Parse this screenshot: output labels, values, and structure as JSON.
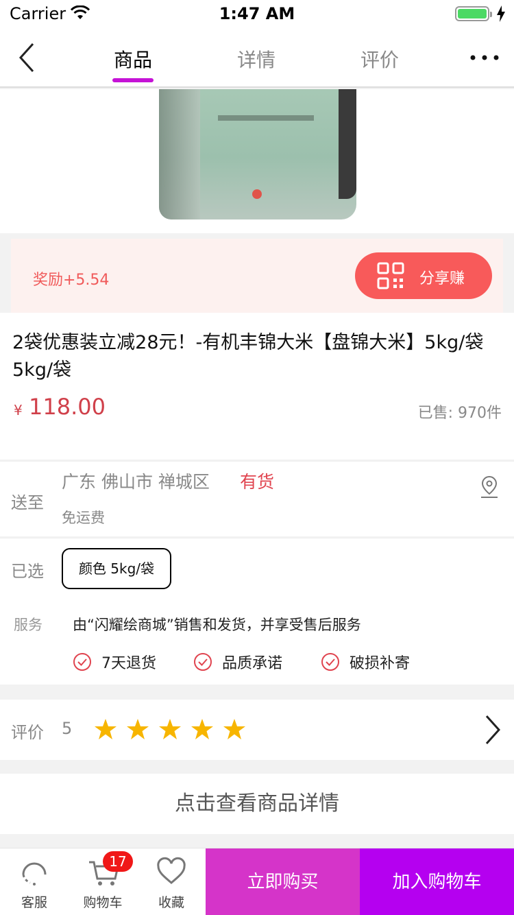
{
  "status_bar": {
    "carrier": "Carrier",
    "time": "1:47 AM",
    "battery_level": 1.0
  },
  "nav": {
    "back_icon": "chevron-left-icon",
    "tabs": [
      {
        "label": "商品",
        "active": true
      },
      {
        "label": "详情",
        "active": false
      },
      {
        "label": "评价",
        "active": false
      }
    ],
    "more_icon": "more-horizontal-icon",
    "accent_color": "#c513d6"
  },
  "gallery": {
    "image": "rice-bag-photo",
    "page_count": 1,
    "current_page": 1
  },
  "reward": {
    "text": "奖励+5.54",
    "share_label": "分享赚",
    "share_icon": "qr-code-icon",
    "color": "#f85a5a"
  },
  "product": {
    "title": "2袋优惠装立减28元！-有机丰锦大米【盘锦大米】5kg/袋 5kg/袋",
    "currency": "¥",
    "price": "118.00",
    "sold": "已售: 970件",
    "price_color": "#d0404a"
  },
  "shipping": {
    "label": "送至",
    "region": "广东 佛山市 禅城区",
    "stock": "有货",
    "fee": "免运费",
    "location_icon": "map-pin-icon"
  },
  "selection": {
    "label": "已选",
    "value": "颜色 5kg/袋"
  },
  "service": {
    "label": "服务",
    "text": "由“闪耀绘商城”销售和发货，并享受售后服务",
    "items": [
      {
        "label": "7天退货",
        "icon": "check-circle-icon"
      },
      {
        "label": "品质承诺",
        "icon": "check-circle-icon"
      },
      {
        "label": "破损补寄",
        "icon": "check-circle-icon"
      }
    ]
  },
  "reviews": {
    "label": "评价",
    "score": "5",
    "stars": 5,
    "star_color": "#f7b500"
  },
  "detail_link": "点击查看商品详情",
  "bottom_bar": {
    "service": {
      "label": "客服",
      "icon": "headset-icon"
    },
    "cart": {
      "label": "购物车",
      "icon": "cart-icon",
      "badge": "17"
    },
    "favorite": {
      "label": "收藏",
      "icon": "heart-icon"
    },
    "buy_now": "立即购买",
    "add_to_cart": "加入购物车",
    "buy_now_color": "#d534c9",
    "add_to_cart_color": "#b500f0"
  }
}
